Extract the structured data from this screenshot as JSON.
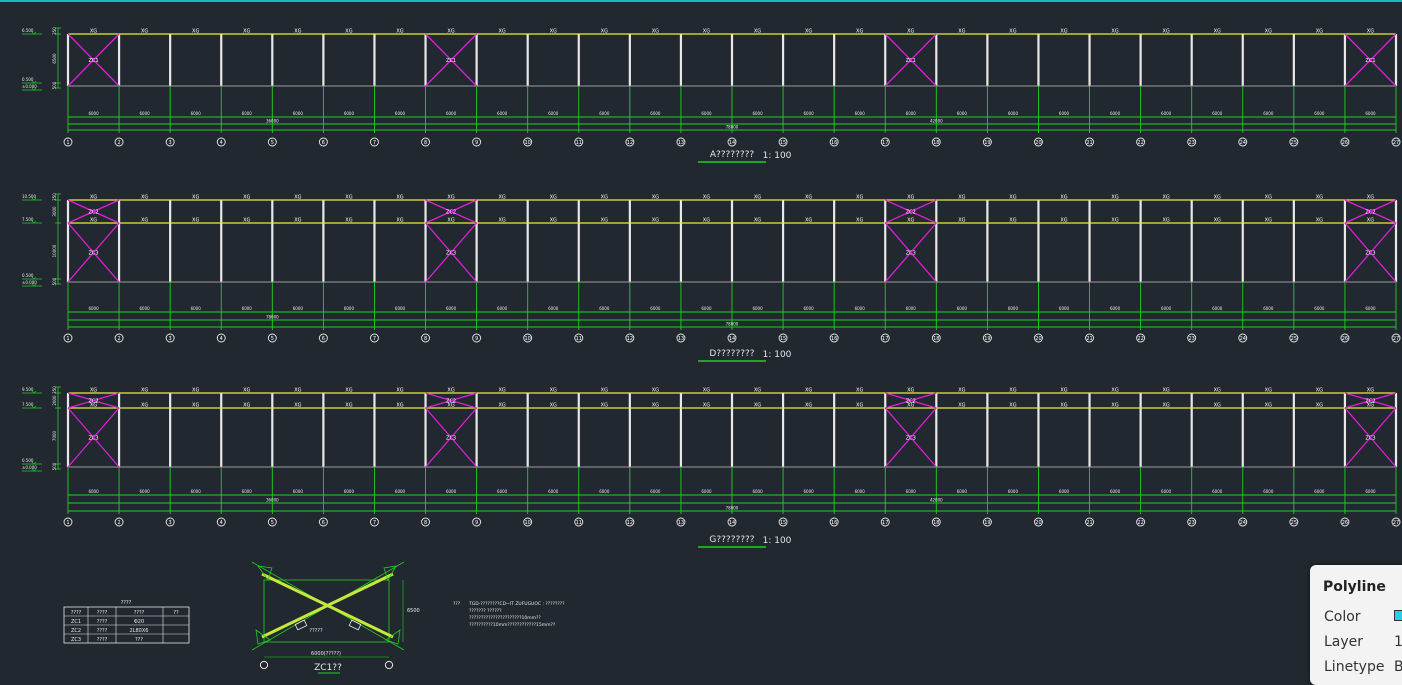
{
  "colors": {
    "background": "#212830",
    "purlin": "#ecec3a",
    "column": "#e8e8e8",
    "brace": "#e01ed9",
    "dimension": "#1fd11f",
    "ground": "#9a9a9a",
    "accent_line": "#1bb6b6"
  },
  "grid_axes": [
    "1",
    "2",
    "3",
    "4",
    "5",
    "6",
    "7",
    "8",
    "9",
    "10",
    "11",
    "12",
    "13",
    "14",
    "15",
    "16",
    "17",
    "18",
    "19",
    "20",
    "21",
    "22",
    "23",
    "24",
    "25",
    "26",
    "27"
  ],
  "brace_bays": [
    1,
    8,
    17,
    26
  ],
  "elevations": [
    {
      "title": "A????????",
      "scale": "1: 100",
      "levels": [
        "6.500",
        "0.500",
        "±0.000"
      ],
      "side_dims": [
        "350",
        "6500",
        "500"
      ],
      "purlin_label": "XG",
      "brace_labels_upper": [],
      "brace_labels_lower": [
        "ZC1",
        "ZC1",
        "ZC1",
        "ZC1"
      ],
      "bay_dim": "6000",
      "total_dims": [
        "36000",
        "78000",
        "42000"
      ]
    },
    {
      "title": "D????????",
      "scale": "1: 100",
      "levels": [
        "10.500",
        "7.500",
        "0.500",
        "±0.000"
      ],
      "side_dims": [
        "350",
        "3000",
        "10000",
        "500"
      ],
      "purlin_label": "XG",
      "brace_labels_upper": [
        "ZC2",
        "ZC2",
        "ZC2",
        "ZC2"
      ],
      "brace_labels_lower": [
        "ZC3",
        "ZC3",
        "ZC3",
        "ZC3"
      ],
      "bay_dim": "6000",
      "total_dims": [
        "78000"
      ]
    },
    {
      "title": "G????????",
      "scale": "1: 100",
      "levels": [
        "9.500",
        "7.500",
        "0.500",
        "±0.000"
      ],
      "side_dims": [
        "350",
        "2000",
        "7000",
        "500"
      ],
      "purlin_label": "XG",
      "brace_labels_upper": [
        "ZC2",
        "ZC2",
        "ZC2",
        "ZC2"
      ],
      "brace_labels_lower": [
        "ZC3",
        "ZC3",
        "ZC3",
        "ZC3"
      ],
      "bay_dim": "6000",
      "total_dims": [
        "36000",
        "78000",
        "42000"
      ]
    }
  ],
  "table": {
    "title": "????",
    "headers": [
      "????",
      "????",
      "????",
      "??"
    ],
    "rows": [
      [
        "ZC1",
        "????",
        "Φ20",
        ""
      ],
      [
        "ZC2",
        "????",
        "2L80X6",
        ""
      ],
      [
        "ZC3",
        "????",
        "???",
        ""
      ]
    ]
  },
  "detail": {
    "label": "ZC1??",
    "side_dim": "6500",
    "bottom_dim": "6000(?????)",
    "rod_note": "?????"
  },
  "notes": {
    "heading": "???",
    "lines": [
      "TGD-????????CD~IT ZUFUGUOC : ????????",
      "??????? ??????",
      "??????????????????????10mm??",
      "??????????10mm????????????15mm??"
    ]
  },
  "properties": {
    "title": "Polyline",
    "rows": [
      {
        "label": "Color",
        "value": ""
      },
      {
        "label": "Layer",
        "value": "1"
      },
      {
        "label": "Linetype",
        "value": "B"
      }
    ],
    "color_swatch": "#22d3e6"
  }
}
